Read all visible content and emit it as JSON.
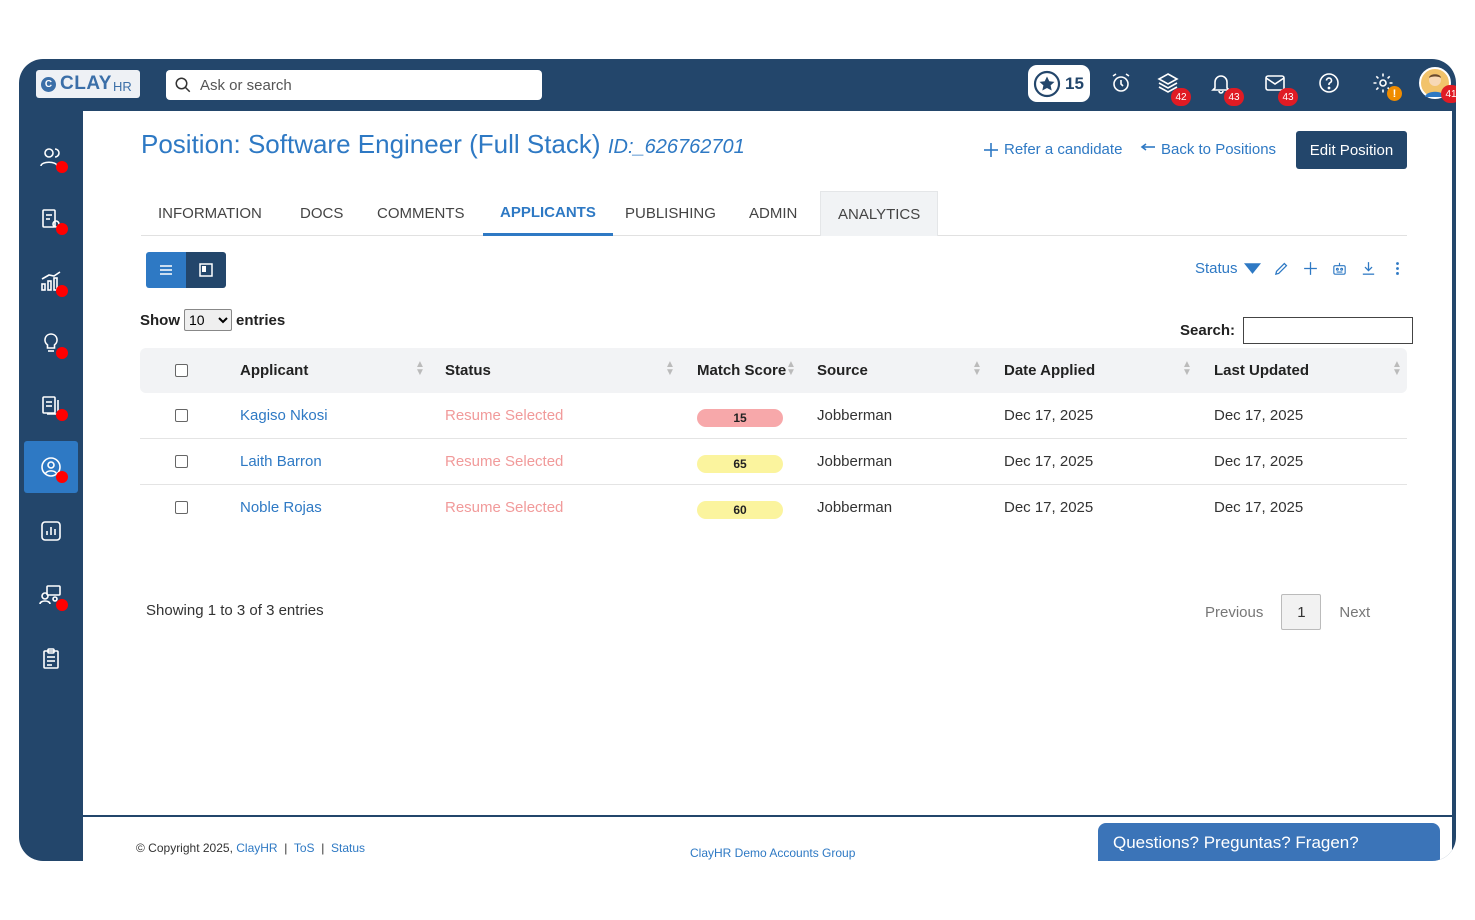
{
  "brand": {
    "name": "CLAY",
    "suffix": "HR",
    "mark": "C"
  },
  "search": {
    "placeholder": "Ask or search"
  },
  "topbar": {
    "stars_count": "15",
    "badges": {
      "layers": "42",
      "bell": "43",
      "mail": "43",
      "settings": "!",
      "avatar": "41"
    }
  },
  "position": {
    "title": "Position: Software Engineer (Full Stack)",
    "id": "ID:_626762701",
    "refer_label": "Refer a candidate",
    "back_label": "Back to Positions",
    "edit_label": "Edit Position"
  },
  "tabs": [
    "INFORMATION",
    "DOCS",
    "COMMENTS",
    "APPLICANTS",
    "PUBLISHING",
    "ADMIN",
    "ANALYTICS"
  ],
  "active_tab": "APPLICANTS",
  "toolbar": {
    "status_label": "Status"
  },
  "table_controls": {
    "show_label": "Show",
    "entries_value": "10",
    "entries_label": "entries",
    "search_label": "Search:"
  },
  "table": {
    "columns": [
      "Applicant",
      "Status",
      "Match Score",
      "Source",
      "Date Applied",
      "Last Updated"
    ],
    "rows": [
      {
        "applicant": "Kagiso Nkosi",
        "status": "Resume Selected",
        "score": "15",
        "source": "Jobberman",
        "applied": "Dec 17, 2025",
        "updated": "Dec 17, 2025"
      },
      {
        "applicant": "Laith Barron",
        "status": "Resume Selected",
        "score": "65",
        "source": "Jobberman",
        "applied": "Dec 17, 2025",
        "updated": "Dec 17, 2025"
      },
      {
        "applicant": "Noble Rojas",
        "status": "Resume Selected",
        "score": "60",
        "source": "Jobberman",
        "applied": "Dec 17, 2025",
        "updated": "Dec 17, 2025"
      }
    ]
  },
  "pagination": {
    "info": "Showing 1 to 3 of 3 entries",
    "previous": "Previous",
    "page": "1",
    "next": "Next"
  },
  "footer": {
    "copyright": "© Copyright 2025,",
    "company_link": "ClayHR",
    "tos": "ToS",
    "status": "Status",
    "center": "ClayHR Demo Accounts Group",
    "help": "Questions? Preguntas? Fragen?"
  },
  "colors": {
    "navy": "#23466b",
    "accent": "#2e79c4",
    "score_low": "#f7a8aa",
    "score_mid": "#fbf49e",
    "status_text": "#f19a9a",
    "notification": "#e01b24"
  },
  "sidebar_icons": [
    "people-icon",
    "document-gear-icon",
    "chart-growth-icon",
    "lightbulb-icon",
    "copy-document-icon",
    "user-circle-icon",
    "bar-chart-icon",
    "team-board-icon",
    "checklist-icon"
  ]
}
